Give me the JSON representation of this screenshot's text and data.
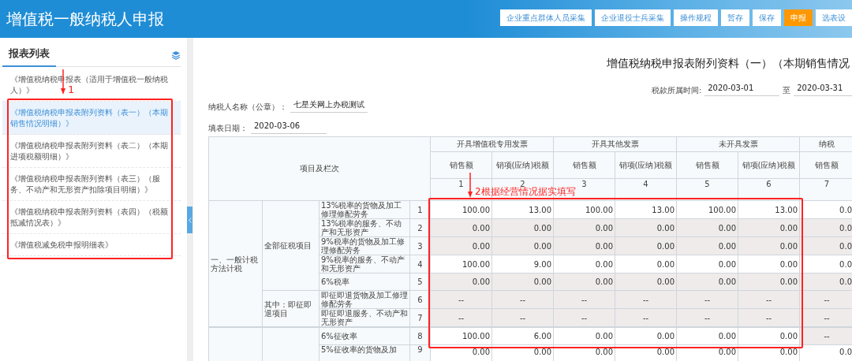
{
  "header": {
    "title": "增值税一般纳税人申报",
    "buttons": [
      {
        "label": "企业重点群体人员采集",
        "kind": "default"
      },
      {
        "label": "企业退役士兵采集",
        "kind": "default"
      },
      {
        "label": "操作规程",
        "kind": "default"
      },
      {
        "label": "暂存",
        "kind": "default"
      },
      {
        "label": "保存",
        "kind": "default"
      },
      {
        "label": "申报",
        "kind": "primary"
      },
      {
        "label": "选表设",
        "kind": "default"
      }
    ]
  },
  "sidebar": {
    "title": "报表列表",
    "annotation": {
      "label": "1"
    },
    "items": [
      {
        "label": "《增值税纳税申报表（适用于增值税一般纳税人）》",
        "selected": false
      },
      {
        "label": "《增值税纳税申报表附列资料（表一）（本期销售情况明细）》",
        "selected": true
      },
      {
        "label": "《增值税纳税申报表附列资料（表二）（本期进项税额明细）》",
        "selected": false
      },
      {
        "label": "《增值税纳税申报表附列资料（表三）（服务、不动产和无形资产扣除项目明细）》",
        "selected": false
      },
      {
        "label": "《增值税纳税申报表附列资料（表四）（税额抵减情况表）》",
        "selected": false
      },
      {
        "label": "《增值税减免税申报明细表》",
        "selected": false
      }
    ]
  },
  "form": {
    "title": "增值税纳税申报表附列资料（一）（本期销售情况",
    "period": {
      "label": "税款所属时间:",
      "from": "2020-03-01",
      "separator": "至",
      "to": "2020-03-31"
    },
    "taxpayer": {
      "label": "纳税人名称（公章）：",
      "value": "七星关网上办税测试"
    },
    "fill_date": {
      "label": "填表日期：",
      "value": "2020-03-06"
    },
    "table": {
      "corner": "项目及栏次",
      "annotation": {
        "label": "2根据经营情况据实填写"
      },
      "groups": [
        {
          "label": "开具增值税专用发票"
        },
        {
          "label": "开具其他发票"
        },
        {
          "label": "未开具发票"
        },
        {
          "label": "纳税"
        }
      ],
      "columns": [
        {
          "label": "销售额",
          "number": "1"
        },
        {
          "label": "销项(应纳)税额",
          "number": "2"
        },
        {
          "label": "销售额",
          "number": "3"
        },
        {
          "label": "销项(应纳)税额",
          "number": "4"
        },
        {
          "label": "销售额",
          "number": "5"
        },
        {
          "label": "销项(应纳)税额",
          "number": "6"
        },
        {
          "label": "销售额",
          "number": "7"
        }
      ],
      "sections": [
        {
          "label": "一、一般计税方法计税",
          "subsections": [
            {
              "label": "全部征税项目",
              "rows": [
                {
                  "label": "13%税率的货物及加工修理修配劳务",
                  "number": "1",
                  "cells": [
                    {
                      "text": "100.00",
                      "editable": true
                    },
                    {
                      "text": "13.00",
                      "editable": true
                    },
                    {
                      "text": "100.00",
                      "editable": true
                    },
                    {
                      "text": "13.00",
                      "editable": true
                    },
                    {
                      "text": "100.00",
                      "editable": true
                    },
                    {
                      "text": "13.00",
                      "editable": true
                    },
                    {
                      "text": "0.0",
                      "editable": true
                    }
                  ]
                },
                {
                  "label": "13%税率的服务、不动产和无形资产",
                  "number": "2",
                  "cells": [
                    {
                      "text": "0.00",
                      "editable": false
                    },
                    {
                      "text": "0.00",
                      "editable": false
                    },
                    {
                      "text": "0.00",
                      "editable": false
                    },
                    {
                      "text": "0.00",
                      "editable": false
                    },
                    {
                      "text": "0.00",
                      "editable": false
                    },
                    {
                      "text": "0.00",
                      "editable": false
                    },
                    {
                      "text": "0.0",
                      "editable": false
                    }
                  ]
                },
                {
                  "label": "9%税率的货物及加工修理修配劳务",
                  "number": "3",
                  "cells": [
                    {
                      "text": "0.00",
                      "editable": false
                    },
                    {
                      "text": "0.00",
                      "editable": false
                    },
                    {
                      "text": "0.00",
                      "editable": false
                    },
                    {
                      "text": "0.00",
                      "editable": false
                    },
                    {
                      "text": "0.00",
                      "editable": false
                    },
                    {
                      "text": "0.00",
                      "editable": false
                    },
                    {
                      "text": "0.0",
                      "editable": false
                    }
                  ]
                },
                {
                  "label": "9%税率的服务、不动产和无形资产",
                  "number": "4",
                  "cells": [
                    {
                      "text": "100.00",
                      "editable": true
                    },
                    {
                      "text": "9.00",
                      "editable": true
                    },
                    {
                      "text": "0.00",
                      "editable": true
                    },
                    {
                      "text": "0.00",
                      "editable": true
                    },
                    {
                      "text": "0.00",
                      "editable": true
                    },
                    {
                      "text": "0.00",
                      "editable": true
                    },
                    {
                      "text": "0.0",
                      "editable": true
                    }
                  ]
                },
                {
                  "label": "6%税率",
                  "number": "5",
                  "cells": [
                    {
                      "text": "0.00",
                      "editable": false
                    },
                    {
                      "text": "0.00",
                      "editable": false
                    },
                    {
                      "text": "0.00",
                      "editable": false
                    },
                    {
                      "text": "0.00",
                      "editable": false
                    },
                    {
                      "text": "0.00",
                      "editable": false
                    },
                    {
                      "text": "0.00",
                      "editable": false
                    },
                    {
                      "text": "0.0",
                      "editable": false
                    }
                  ]
                }
              ]
            },
            {
              "label": "其中：即征即退项目",
              "rows": [
                {
                  "label": "即征即退货物及加工修理修配劳务",
                  "number": "6",
                  "cells": [
                    {
                      "text": "--",
                      "editable": false
                    },
                    {
                      "text": "--",
                      "editable": false
                    },
                    {
                      "text": "--",
                      "editable": false
                    },
                    {
                      "text": "--",
                      "editable": false
                    },
                    {
                      "text": "--",
                      "editable": false
                    },
                    {
                      "text": "--",
                      "editable": false
                    },
                    {
                      "text": "--",
                      "editable": false
                    }
                  ]
                },
                {
                  "label": "即征即退服务、不动产和无形资产",
                  "number": "7",
                  "cells": [
                    {
                      "text": "--",
                      "editable": false
                    },
                    {
                      "text": "--",
                      "editable": false
                    },
                    {
                      "text": "--",
                      "editable": false
                    },
                    {
                      "text": "--",
                      "editable": false
                    },
                    {
                      "text": "--",
                      "editable": false
                    },
                    {
                      "text": "--",
                      "editable": false
                    },
                    {
                      "text": "--",
                      "editable": false
                    }
                  ]
                }
              ]
            }
          ]
        },
        {
          "subsections": [
            {
              "rows": [
                {
                  "label": "6%征收率",
                  "number": "8",
                  "cells": [
                    {
                      "text": "100.00",
                      "editable": true
                    },
                    {
                      "text": "6.00",
                      "editable": true
                    },
                    {
                      "text": "0.00",
                      "editable": true
                    },
                    {
                      "text": "0.00",
                      "editable": true
                    },
                    {
                      "text": "0.00",
                      "editable": true
                    },
                    {
                      "text": "0.00",
                      "editable": true
                    },
                    {
                      "text": "--",
                      "editable": false
                    }
                  ]
                },
                {
                  "label": "5%征收率的货物及加",
                  "number": "9",
                  "cells": [
                    {
                      "text": "0.00",
                      "editable": true
                    },
                    {
                      "text": "0.00",
                      "editable": true
                    },
                    {
                      "text": "0.00",
                      "editable": true
                    },
                    {
                      "text": "0.00",
                      "editable": true
                    },
                    {
                      "text": "0.00",
                      "editable": true
                    },
                    {
                      "text": "0.00",
                      "editable": true
                    },
                    {
                      "text": "0.0",
                      "editable": true
                    }
                  ]
                }
              ]
            }
          ]
        }
      ]
    }
  }
}
